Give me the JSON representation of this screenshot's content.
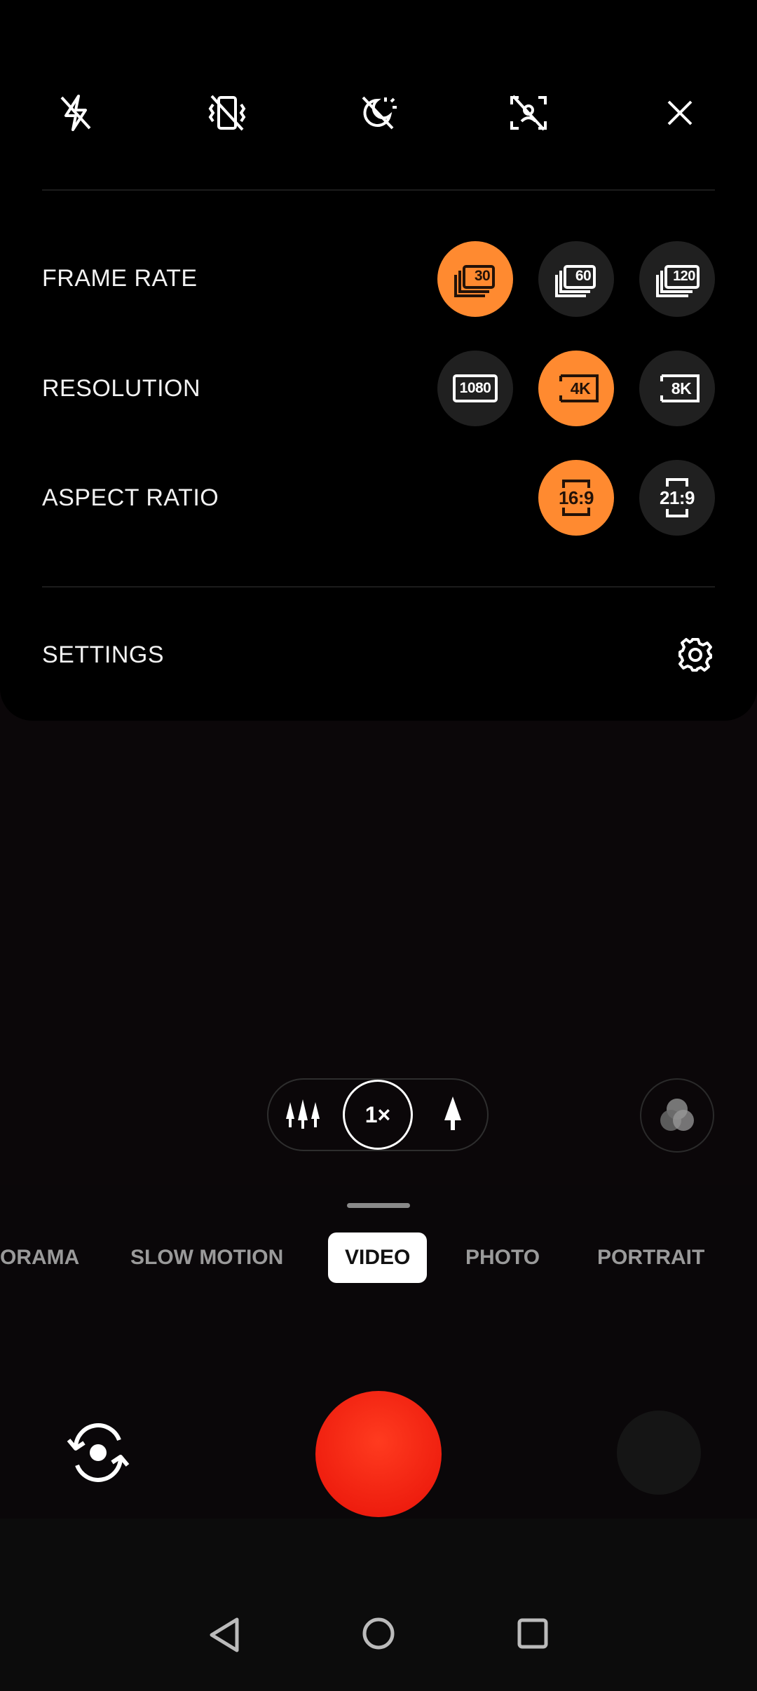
{
  "quick_settings": {
    "icons": [
      "flash-off-icon",
      "vibrate-off-icon",
      "night-mode-off-icon",
      "focus-off-icon",
      "close-icon"
    ]
  },
  "frame_rate": {
    "label": "FRAME RATE",
    "options": [
      "30",
      "60",
      "120"
    ],
    "selected": "30"
  },
  "resolution": {
    "label": "RESOLUTION",
    "options": [
      "1080",
      "4K",
      "8K"
    ],
    "selected": "4K"
  },
  "aspect_ratio": {
    "label": "ASPECT RATIO",
    "options": [
      "16:9",
      "21:9"
    ],
    "selected": "16:9"
  },
  "settings": {
    "label": "SETTINGS",
    "icon": "gear-icon"
  },
  "zoom": {
    "current": "1×"
  },
  "modes": {
    "items": [
      "ORAMA",
      "SLOW MOTION",
      "VIDEO",
      "PHOTO",
      "PORTRAIT"
    ],
    "active": "VIDEO"
  },
  "colors": {
    "accent": "#ff8a30",
    "record": "#f01a0c"
  }
}
